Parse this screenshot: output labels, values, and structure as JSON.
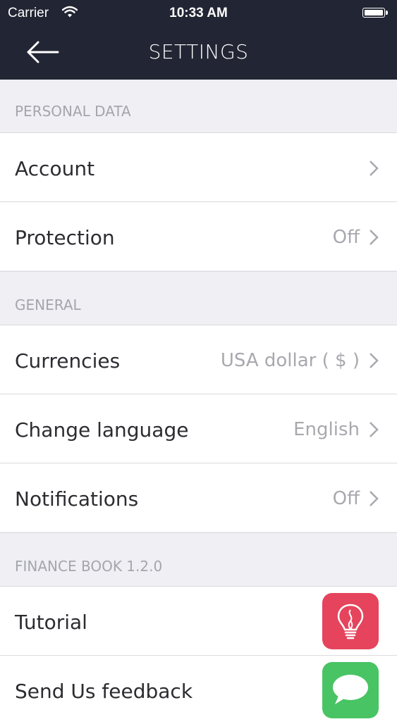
{
  "status_bar": {
    "carrier": "Carrier",
    "time": "10:33 AM"
  },
  "nav": {
    "title": "SETTINGS",
    "back_icon": "arrow-left-icon"
  },
  "sections": {
    "personal": {
      "title": "PERSONAL DATA",
      "account_label": "Account",
      "protection_label": "Protection",
      "protection_value": "Off"
    },
    "general": {
      "title": "GENERAL",
      "currencies_label": "Currencies",
      "currencies_value": "USA dollar ( $ )",
      "language_label": "Change language",
      "language_value": "English",
      "notifications_label": "Notifications",
      "notifications_value": "Off"
    },
    "about": {
      "title": "FINANCE BOOK 1.2.0",
      "tutorial_label": "Tutorial",
      "tutorial_icon": "lightbulb-icon",
      "feedback_label": "Send Us feedback",
      "feedback_icon": "speech-bubble-icon"
    }
  },
  "colors": {
    "header_bg": "#222533",
    "page_bg": "#efeff4",
    "tutorial_icon_bg": "#e5445c",
    "feedback_icon_bg": "#49c464"
  }
}
